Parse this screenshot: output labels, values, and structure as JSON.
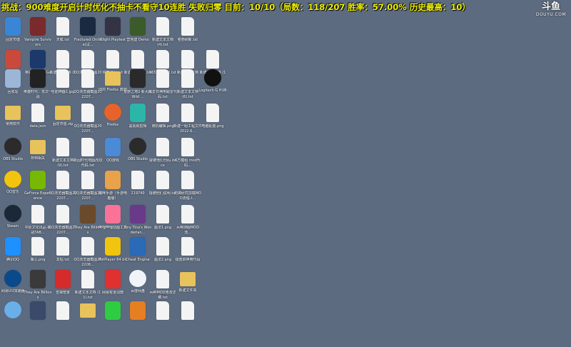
{
  "overlay": {
    "text": "挑战：900难度开启计时优化不抽卡不看守10连胜 失败归零 目前：10/10（局数：118/207 胜率：57.00% 历史最高：10）"
  },
  "watermark": {
    "logo": "斗鱼",
    "domain": "DOUYU.COM"
  },
  "colors": {
    "desktop_bg": "#5c6b80",
    "overlay_text": "#f2f200"
  },
  "icons": [
    {
      "label": "固定市值",
      "glyph": "app",
      "color": "#3a86d6"
    },
    {
      "label": "Vampire Survivors",
      "glyph": "app",
      "color": "#7a2a2a"
    },
    {
      "label": "天赋.txt",
      "glyph": "file",
      "color": ""
    },
    {
      "label": "Fractured Online(试...",
      "glyph": "app",
      "color": "#1a2a40"
    },
    {
      "label": "Blight Playtest",
      "glyph": "app",
      "color": "#334"
    },
    {
      "label": "营地建 Demo",
      "glyph": "app",
      "color": "#3b5b2b"
    },
    {
      "label": "新建文本文档 (4).txt",
      "glyph": "file",
      "color": ""
    },
    {
      "label": "卷野刷新.txt",
      "glyph": "file",
      "color": ""
    },
    {
      "label": "请大师",
      "glyph": "app",
      "color": "#c94a3a"
    },
    {
      "label": "英雄联盟 WeGame版",
      "glyph": "app",
      "color": "#1b3a6b"
    },
    {
      "label": "新建文本文档 (10).txt",
      "glyph": "file",
      "color": ""
    },
    {
      "label": "QQ浏览器截图202207...",
      "glyph": "file",
      "color": ""
    },
    {
      "label": "候司说明.txt",
      "glyph": "file",
      "color": ""
    },
    {
      "label": "新建文本文档.txt",
      "glyph": "file",
      "color": ""
    },
    {
      "label": "965最终名单.txt",
      "glyph": "file",
      "color": ""
    },
    {
      "label": "新建文本文档 (5).txt",
      "glyph": "file",
      "color": ""
    },
    {
      "label": "新建文本文档 (12).txt",
      "glyph": "file",
      "color": ""
    },
    {
      "label": "回收站",
      "glyph": "app",
      "color": "#9bb6d6"
    },
    {
      "label": "英雄时代：攻次一战",
      "glyph": "app",
      "color": "#222"
    },
    {
      "label": "包肥神器2.jpg",
      "glyph": "file",
      "color": ""
    },
    {
      "label": "QQ浏览器截图202207...",
      "glyph": "file",
      "color": ""
    },
    {
      "label": "旧的 Firefox 数据",
      "glyph": "folder",
      "color": ""
    },
    {
      "label": "荒野之地2·新大陆 Wild ...",
      "glyph": "app",
      "color": "#2a2a2a"
    },
    {
      "label": "最爱日神用跟爱代码.txt",
      "glyph": "file",
      "color": ""
    },
    {
      "label": "新建文本文档 (6).txt",
      "glyph": "file",
      "color": ""
    },
    {
      "label": "Logitech G HUB",
      "glyph": "round",
      "color": "#111"
    },
    {
      "label": "常用软件",
      "glyph": "folder",
      "color": ""
    },
    {
      "label": "data.json",
      "glyph": "file",
      "color": ""
    },
    {
      "label": "固定市值.zip",
      "glyph": "folder",
      "color": ""
    },
    {
      "label": "QQ浏览器截图202207...",
      "glyph": "file",
      "color": ""
    },
    {
      "label": "Firefox",
      "glyph": "round",
      "color": "#e8632b"
    },
    {
      "label": "黑视频剪辑",
      "glyph": "app",
      "color": "#2bb6a8"
    },
    {
      "label": "剩机编辑.png",
      "glyph": "file",
      "color": ""
    },
    {
      "label": "新建一组工程文件2022.6...",
      "glyph": "file",
      "color": ""
    },
    {
      "label": "电脑配置.png",
      "glyph": "file",
      "color": ""
    },
    {
      "label": "OBS Studio",
      "glyph": "round",
      "color": "#2b2b2b"
    },
    {
      "label": "存档相关",
      "glyph": "folder",
      "color": ""
    },
    {
      "label": "新建文本文档 (9).txt",
      "glyph": "file",
      "color": ""
    },
    {
      "label": "新固时代地图改动代码.txt",
      "glyph": "file",
      "color": ""
    },
    {
      "label": "QQ游戏",
      "glyph": "app",
      "color": "#4a8ad6"
    },
    {
      "label": "OBS Studio",
      "glyph": "round",
      "color": "#2b2b2b"
    },
    {
      "label": "疑被他们代码.docx",
      "glyph": "file",
      "color": ""
    },
    {
      "label": "6万模组 mod代码...",
      "glyph": "file",
      "color": ""
    },
    {
      "label": "QQ音乐",
      "glyph": "round",
      "color": "#f1c40f"
    },
    {
      "label": "GeForce Experience",
      "glyph": "app",
      "color": "#76b900"
    },
    {
      "label": "QQ浏览器截图202207...",
      "glyph": "file",
      "color": ""
    },
    {
      "label": "QQ浏览器截图202207...",
      "glyph": "file",
      "color": ""
    },
    {
      "label": "猫咪手游（手游电脑版）",
      "glyph": "app",
      "color": "#e8a24a"
    },
    {
      "label": "219740",
      "glyph": "file",
      "color": ""
    },
    {
      "label": "疑被他们说明.txt",
      "glyph": "file",
      "color": ""
    },
    {
      "label": "防御研究加载MOD流程.t...",
      "glyph": "file",
      "color": ""
    },
    {
      "label": "Steam",
      "glyph": "round",
      "color": "#1b2838"
    },
    {
      "label": "中原文化出品·挑战TAB...",
      "glyph": "file",
      "color": ""
    },
    {
      "label": "QQ浏览器截图202207...",
      "glyph": "file",
      "color": ""
    },
    {
      "label": "They Are Billions",
      "glyph": "app",
      "color": "#6a4a2a"
    },
    {
      "label": "哔哩哔哩动画工具",
      "glyph": "app",
      "color": "#fb7299"
    },
    {
      "label": "Tiny Tina's Wonderlan...",
      "glyph": "app",
      "color": "#6a3a8a"
    },
    {
      "label": "画法1.png",
      "glyph": "file",
      "color": ""
    },
    {
      "label": "兵种测服MOD流...",
      "glyph": "file",
      "color": ""
    },
    {
      "label": "腾讯QQ",
      "glyph": "app",
      "color": "#1e90ff"
    },
    {
      "label": "萌心.png",
      "glyph": "file",
      "color": ""
    },
    {
      "label": "发帖.txt",
      "glyph": "file",
      "color": ""
    },
    {
      "label": "QQ浏览器截图202208...",
      "glyph": "file",
      "color": ""
    },
    {
      "label": "PotPlayer 64 bit",
      "glyph": "app",
      "color": "#f1c40f"
    },
    {
      "label": "Cheat Engine",
      "glyph": "app",
      "color": "#2a6ab6"
    },
    {
      "label": "画法2.png",
      "glyph": "file",
      "color": ""
    },
    {
      "label": "疑兽启神用代码",
      "glyph": "file",
      "color": ""
    },
    {
      "label": "网易UU加速器",
      "glyph": "round",
      "color": "#0a4a8a"
    },
    {
      "label": "They Are Billions",
      "glyph": "app",
      "color": "#3a3a3a"
    },
    {
      "label": "雪狼管家",
      "glyph": "app",
      "color": "#d62b2b"
    },
    {
      "label": "新建文本文档 (11).txt",
      "glyph": "file",
      "color": ""
    },
    {
      "label": "网易有道词典",
      "glyph": "app",
      "color": "#e03030"
    },
    {
      "label": "百度网盘",
      "glyph": "round",
      "color": "#f0f4fa"
    },
    {
      "label": "兵种MOD修改详细.txt",
      "glyph": "file",
      "color": ""
    },
    {
      "label": "新建文件夹",
      "glyph": "folder",
      "color": ""
    },
    {
      "label": "",
      "glyph": "round",
      "color": "#6ab0e8"
    },
    {
      "label": "",
      "glyph": "app",
      "color": "#3a4a6a"
    },
    {
      "label": "",
      "glyph": "file",
      "color": ""
    },
    {
      "label": "",
      "glyph": "folder",
      "color": ""
    },
    {
      "label": "",
      "glyph": "app",
      "color": "#2ecc40"
    },
    {
      "label": "",
      "glyph": "app",
      "color": "#e67e22"
    },
    {
      "label": "",
      "glyph": "file",
      "color": ""
    },
    {
      "label": "",
      "glyph": "file",
      "color": ""
    }
  ]
}
